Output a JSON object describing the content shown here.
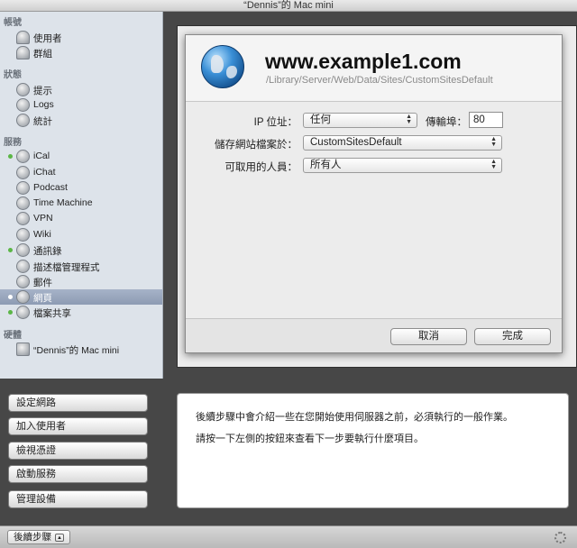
{
  "window": {
    "title": "“Dennis”的 Mac mini"
  },
  "sidebar": {
    "sections": [
      {
        "title": "帳號",
        "items": [
          {
            "label": "使用者",
            "icon": "user-icon",
            "running": false,
            "selected": false
          },
          {
            "label": "群組",
            "icon": "group-icon",
            "running": false,
            "selected": false
          }
        ]
      },
      {
        "title": "狀態",
        "items": [
          {
            "label": "提示",
            "icon": "alert-icon",
            "running": false,
            "selected": false
          },
          {
            "label": "Logs",
            "icon": "logs-icon",
            "running": false,
            "selected": false
          },
          {
            "label": "統計",
            "icon": "stats-icon",
            "running": false,
            "selected": false
          }
        ]
      },
      {
        "title": "服務",
        "items": [
          {
            "label": "iCal",
            "icon": "ical-icon",
            "running": true,
            "selected": false
          },
          {
            "label": "iChat",
            "icon": "ichat-icon",
            "running": false,
            "selected": false
          },
          {
            "label": "Podcast",
            "icon": "podcast-icon",
            "running": false,
            "selected": false
          },
          {
            "label": "Time Machine",
            "icon": "time-machine-icon",
            "running": false,
            "selected": false
          },
          {
            "label": "VPN",
            "icon": "vpn-icon",
            "running": false,
            "selected": false
          },
          {
            "label": "Wiki",
            "icon": "wiki-icon",
            "running": false,
            "selected": false
          },
          {
            "label": "通訊錄",
            "icon": "address-book-icon",
            "running": true,
            "selected": false
          },
          {
            "label": "描述檔管理程式",
            "icon": "profile-manager-icon",
            "running": false,
            "selected": false
          },
          {
            "label": "郵件",
            "icon": "mail-icon",
            "running": false,
            "selected": false
          },
          {
            "label": "網頁",
            "icon": "web-icon",
            "running": true,
            "selected": true
          },
          {
            "label": "檔案共享",
            "icon": "file-sharing-icon",
            "running": true,
            "selected": false
          }
        ]
      },
      {
        "title": "硬體",
        "items": [
          {
            "label": "“Dennis”的 Mac mini",
            "icon": "mac-mini-icon",
            "running": false,
            "selected": false
          }
        ]
      }
    ]
  },
  "sheet": {
    "site_title": "www.example1.com",
    "site_path": "/Library/Server/Web/Data/Sites/CustomSitesDefault",
    "ip_label": "IP 位址：",
    "ip_value": "任何",
    "port_label": "傳輸埠：",
    "port_value": "80",
    "store_label": "儲存網站檔案於：",
    "store_value": "CustomSitesDefault",
    "access_label": "可取用的人員：",
    "access_value": "所有人",
    "cancel_label": "取消",
    "done_label": "完成"
  },
  "tasks": [
    {
      "label": "設定網路"
    },
    {
      "label": "加入使用者"
    },
    {
      "label": "檢視憑證"
    },
    {
      "label": "啟動服務"
    },
    {
      "label": "管理設備"
    }
  ],
  "info": {
    "line1": "後續步驟中會介紹一些在您開始使用伺服器之前，必須執行的一般作業。",
    "line2": "請按一下左側的按鈕來查看下一步要執行什麼項目。"
  },
  "bottom": {
    "next_steps_label": "後續步驟"
  }
}
